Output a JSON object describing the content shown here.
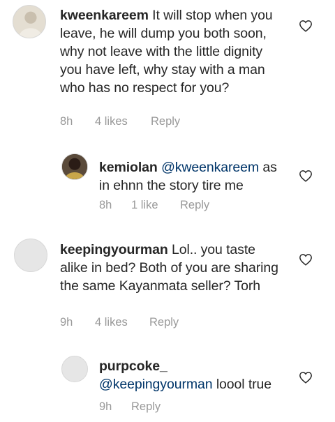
{
  "comments": [
    {
      "username": "kweenkareem",
      "mention": "",
      "text": "It will stop when you leave, he will dump you both soon, why not leave with the little dignity you have left, why stay with a man who has no respect for you?",
      "time": "8h",
      "likes": "4 likes",
      "reply": "Reply",
      "avatar_color": "#d9d2c4"
    },
    {
      "username": "kemiolan",
      "mention": "@kweenkareem",
      "text": "as in ehnn the story tire me",
      "time": "8h",
      "likes": "1 like",
      "reply": "Reply",
      "avatar_color": "#3a2a22"
    },
    {
      "username": "keepingyourman",
      "mention": "",
      "text": "Lol.. you taste alike in bed? Both of you are sharing the same Kayanmata seller? Torh",
      "time": "9h",
      "likes": "4 likes",
      "reply": "Reply",
      "avatar_color": "#ebebeb"
    },
    {
      "username": "purpcoke_",
      "mention": "@keepingyourman",
      "text": "loool true",
      "time": "9h",
      "likes": "",
      "reply": "Reply",
      "avatar_color": "#ebebeb"
    }
  ],
  "icons": {
    "like": "heart-outline-icon"
  },
  "colors": {
    "text": "#262626",
    "meta": "#999999",
    "mention": "#003569"
  }
}
